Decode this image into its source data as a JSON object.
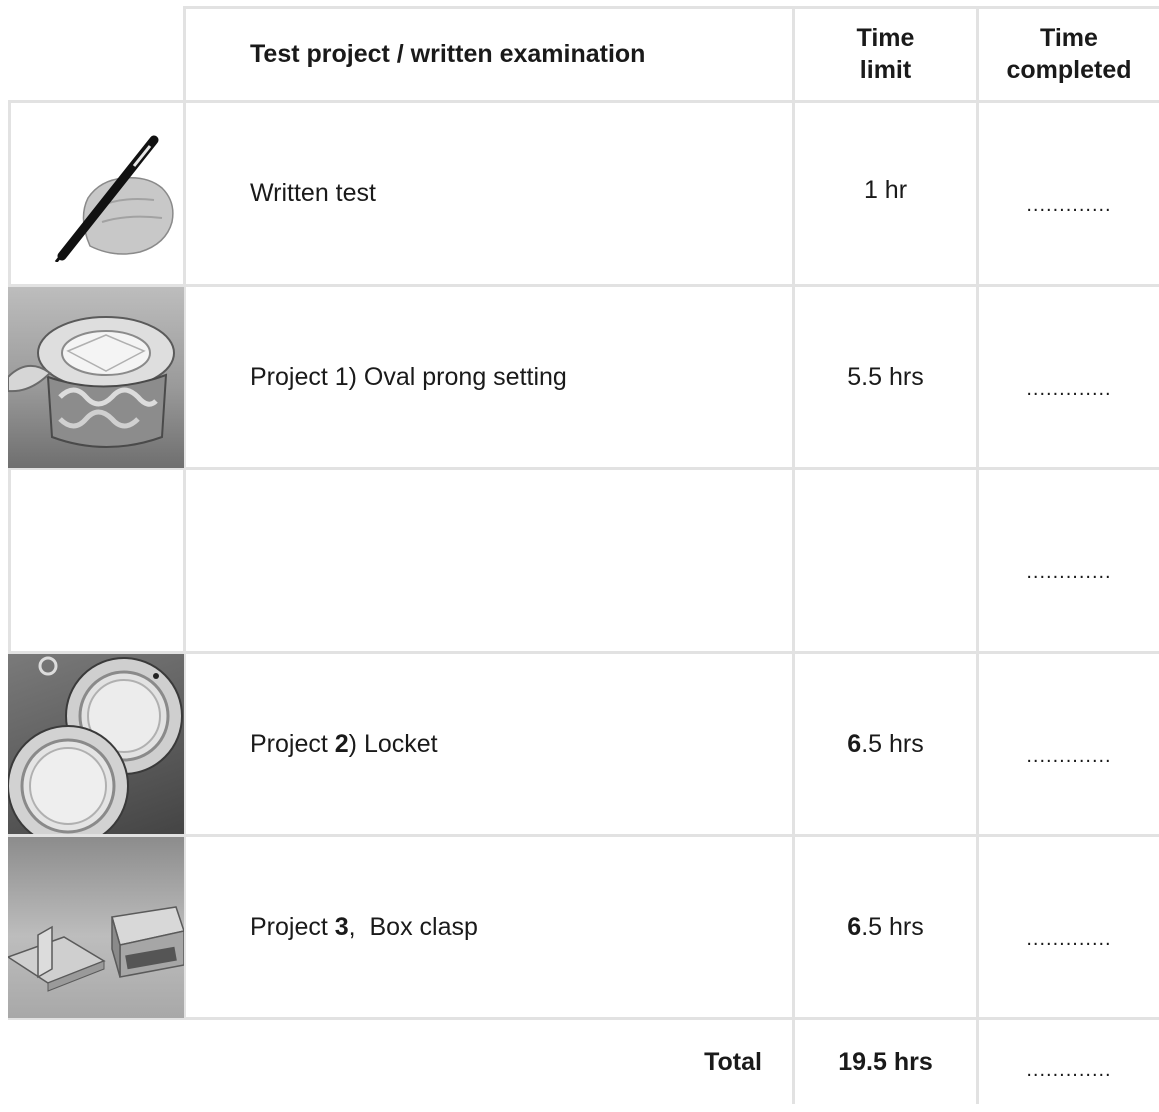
{
  "header": {
    "project_col": "Test project / written examination",
    "limit_line1": "Time",
    "limit_line2": "limit",
    "completed_line1": "Time",
    "completed_line2": "completed"
  },
  "rows": [
    {
      "image": "pen-in-hand-photo",
      "name": "Written test",
      "limit": "1 hr",
      "completed": "............."
    },
    {
      "image": "oval-prong-setting-photo",
      "name": "Project 1) Oval prong setting",
      "limit": "5.5 hrs",
      "completed": "............."
    },
    {
      "image": "",
      "name": "",
      "limit": "",
      "completed": "............."
    },
    {
      "image": "locket-photo",
      "name_pre": "Project ",
      "name_num": "2",
      "name_post": ") Locket",
      "limit_num": "6",
      "limit_rest": ".5 hrs",
      "completed": "............."
    },
    {
      "image": "box-clasp-photo",
      "name_pre": "Project ",
      "name_num": "3",
      "name_post": ",  Box clasp",
      "limit_num": "6",
      "limit_rest": ".5 hrs",
      "completed": "............."
    }
  ],
  "total": {
    "label": "Total",
    "value": "19.5 hrs",
    "completed": "............."
  }
}
